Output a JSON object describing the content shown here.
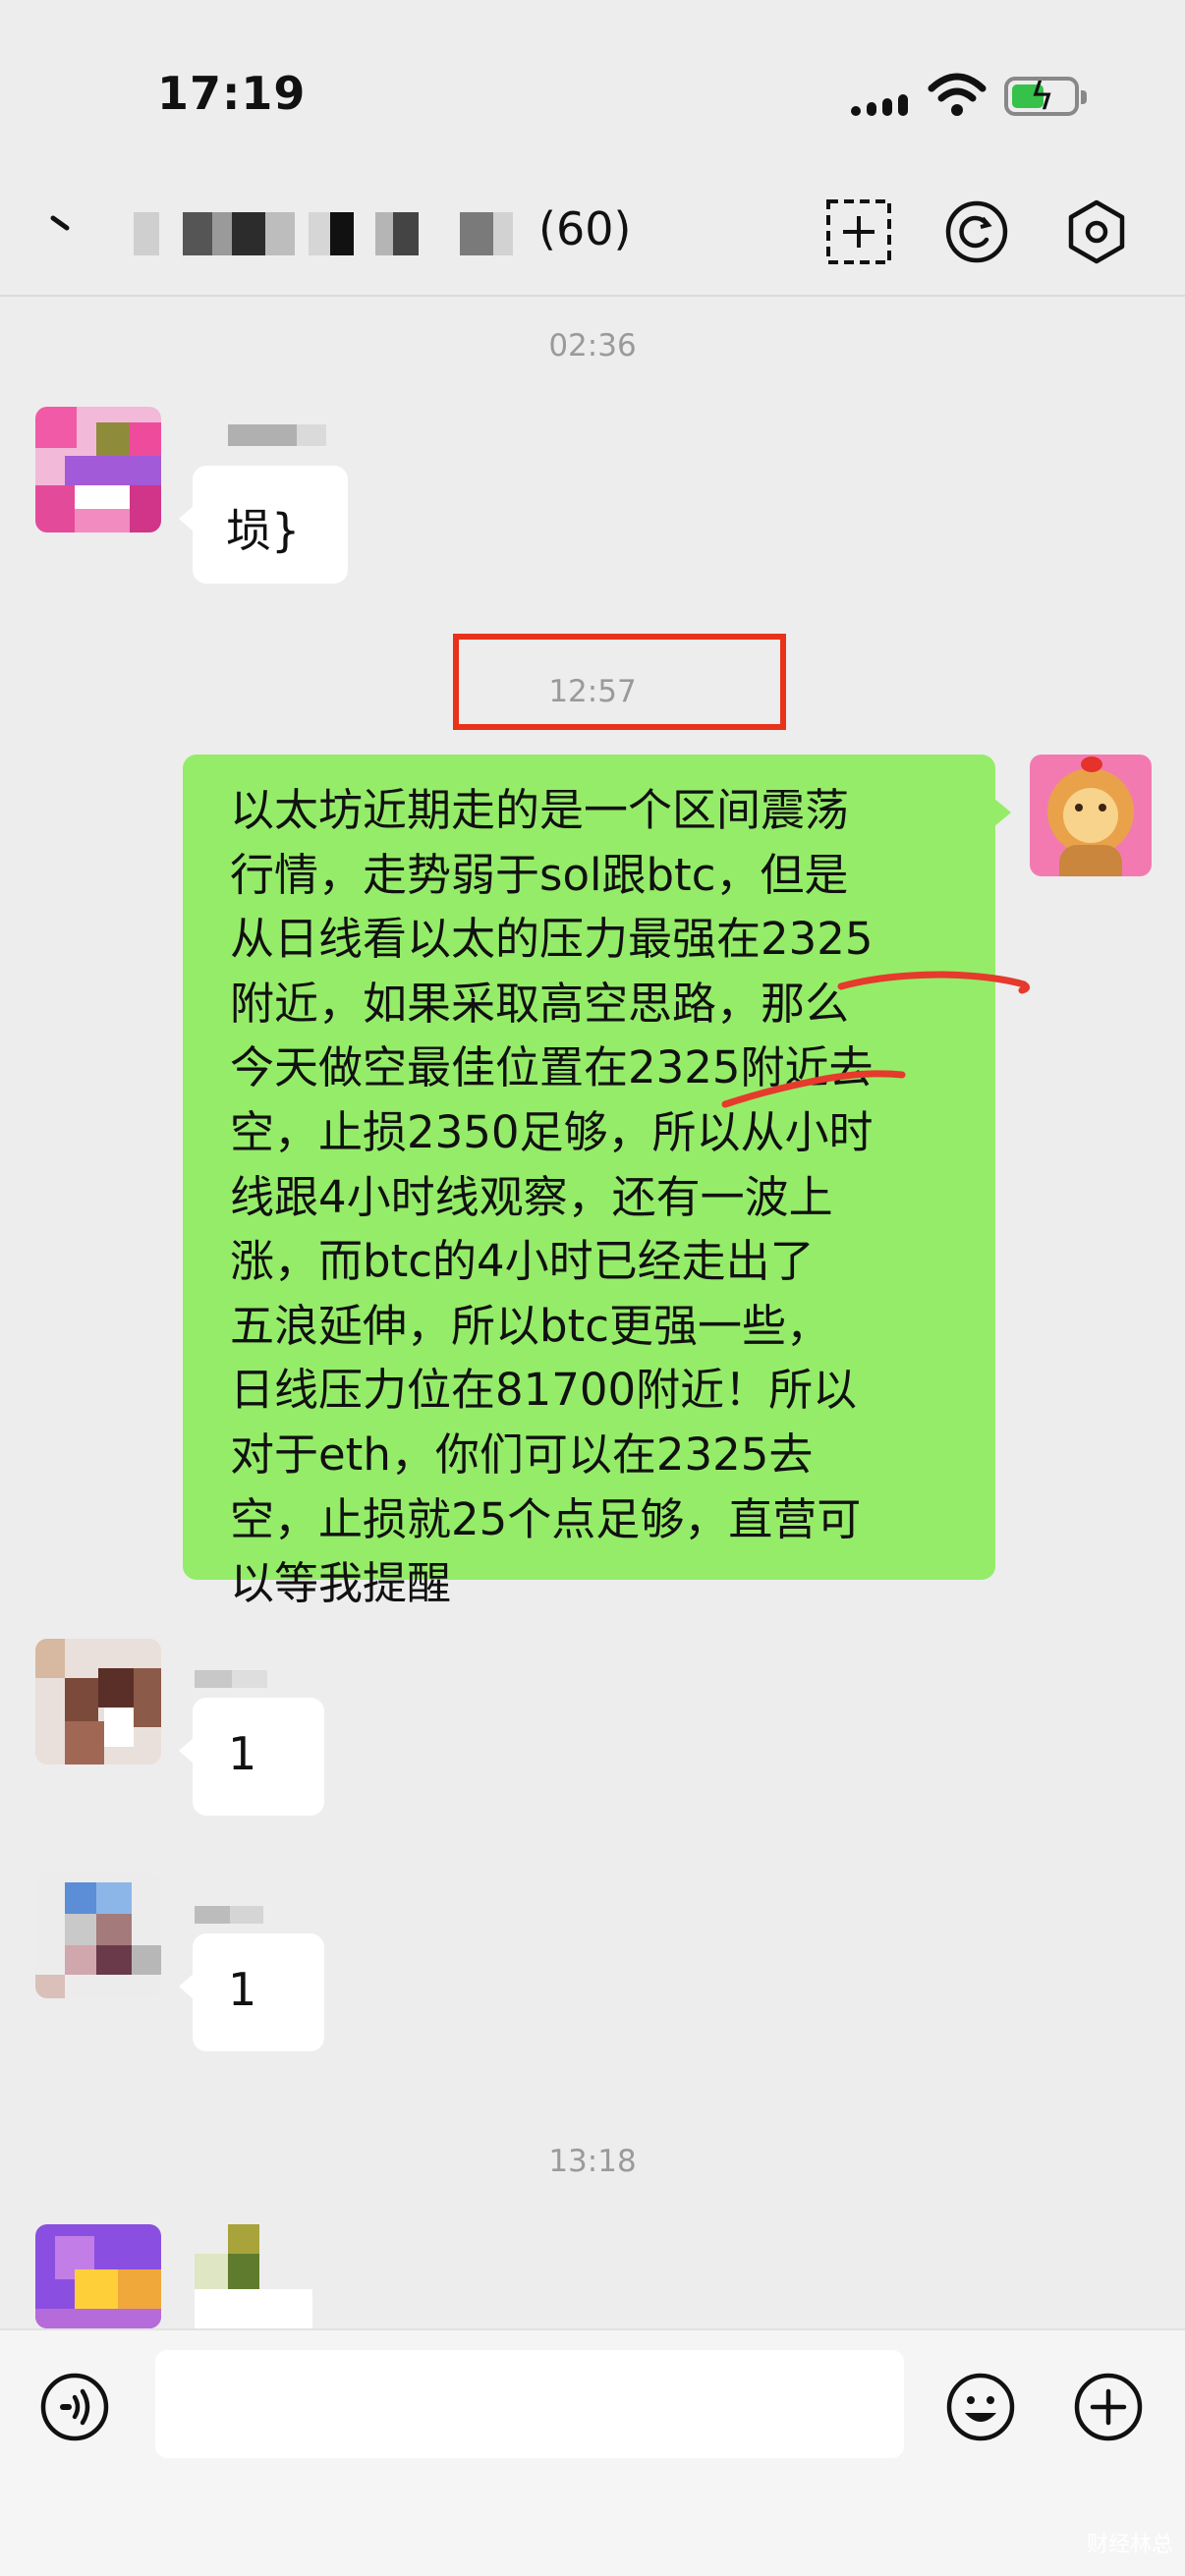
{
  "status_bar": {
    "time": "17:19"
  },
  "header": {
    "title_count": "(60)"
  },
  "timestamps": [
    "02:36",
    "12:57",
    "13:18"
  ],
  "messages": [
    {
      "side": "left",
      "text": "埙}"
    },
    {
      "side": "right",
      "text": "以太坊近期走的是一个区间震荡\n行情，走势弱于sol跟btc，但是\n从日线看以太的压力最强在2325\n附近，如果采取高空思路，那么\n今天做空最佳位置在2325附近去\n空，止损2350足够，所以从小时\n线跟4小时线观察，还有一波上\n涨，而btc的4小时已经走出了\n五浪延伸，所以btc更强一些，\n日线压力位在81700附近！所以\n对于eth，你们可以在2325去\n空，止损就25个点足够，直营可\n以等我提醒"
    },
    {
      "side": "left",
      "text": "1"
    },
    {
      "side": "left",
      "text": "1"
    }
  ],
  "icons": [
    "back-icon",
    "add-member-icon",
    "refresh-icon",
    "settings-icon",
    "voice-icon",
    "emoji-icon",
    "plus-icon"
  ],
  "colors": {
    "bubble_out": "#95ec69",
    "highlight_box": "#e8321a",
    "annotation": "#e8321a",
    "background": "#ededed"
  },
  "watermark": "财经林总"
}
